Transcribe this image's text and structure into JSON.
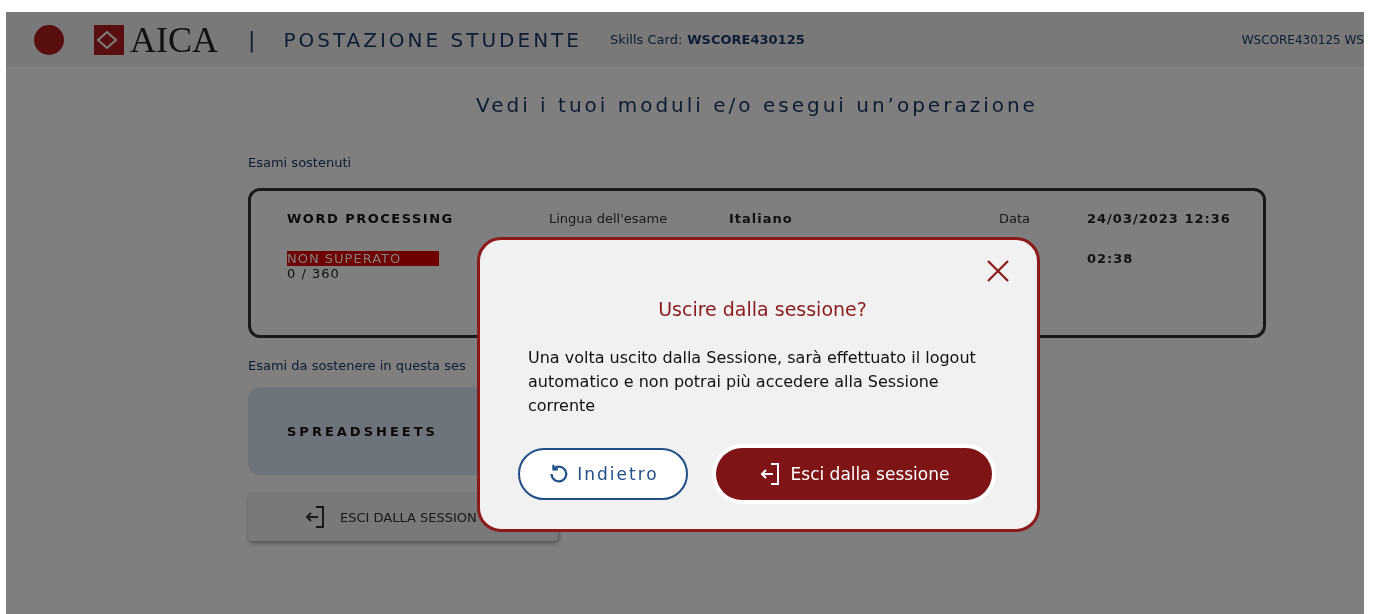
{
  "header": {
    "product": "AICA",
    "section": "POSTAZIONE STUDENTE",
    "skills_card_label": "Skills Card:",
    "skills_card_value": "WSCORE430125",
    "separator": "|",
    "user": "WSCORE430125 WS"
  },
  "page_title": "Vedi i tuoi moduli e/o esegui un’operazione",
  "taken_heading": "Esami sostenuti",
  "taken_exams": [
    {
      "name": "WORD PROCESSING",
      "status": "NON SUPERATO",
      "passed": false,
      "score": "0 / 360",
      "language_label": "Lingua dell'esame",
      "language": "Italiano",
      "date_label": "Data",
      "date": "24/03/2023 12:36",
      "column_6": "02:38"
    }
  ],
  "pending_heading": "Esami da sostenere in questa ses",
  "pending_exams": [
    {
      "name": "SPREADSHEETS"
    }
  ],
  "exit_button": "ESCI DALLA SESSION",
  "dialog": {
    "title": "Uscire dalla sessione?",
    "message": "Una volta uscito dalla Sessione, sarà effettuato il logout automatico e non potrai più accedere alla Sessione corrente",
    "back_button": "Indietro",
    "confirm_button": "Esci dalla sessione"
  }
}
